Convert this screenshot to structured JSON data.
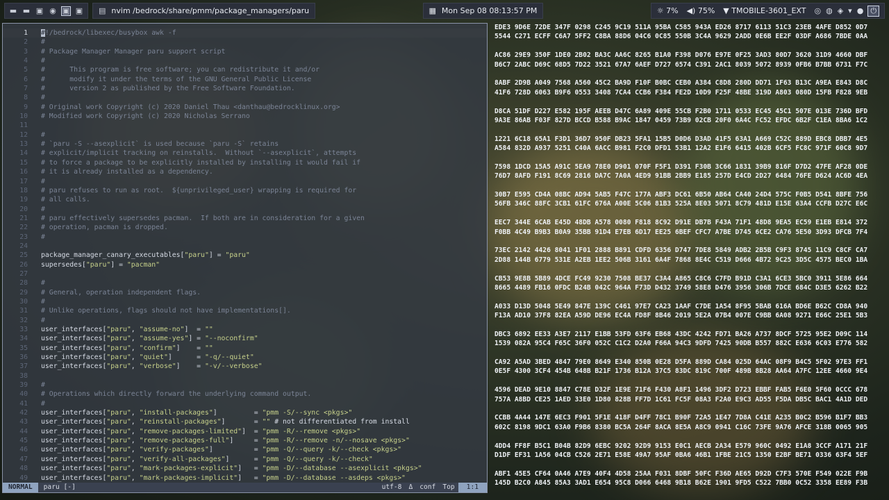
{
  "topbar": {
    "workspaces": [
      {
        "icon": "folder-icon",
        "glyph": "▬",
        "active": false
      },
      {
        "icon": "folder-icon",
        "glyph": "▬",
        "active": false
      },
      {
        "icon": "terminal-icon",
        "glyph": "▣",
        "active": false
      },
      {
        "icon": "browser-icon",
        "glyph": "◉",
        "active": false
      },
      {
        "icon": "terminal-icon",
        "glyph": "▣",
        "active": true
      },
      {
        "icon": "terminal-icon",
        "glyph": "▣",
        "active": false
      }
    ],
    "window_title": "nvim /bedrock/share/pmm/package_managers/paru",
    "clock": "Mon Sep 08  08:13:57 PM",
    "brightness": "7%",
    "volume": "75%",
    "wifi": "TMOBILE-3601_EXT",
    "tray": [
      "discord-icon",
      "steam-icon",
      "network-icon",
      "notification-icon",
      "github-icon",
      "power-icon"
    ]
  },
  "editor": {
    "lines": [
      {
        "n": "1",
        "t": "#!/bedrock/libexec/busybox awk -f",
        "k": "c",
        "cur": true
      },
      {
        "n": "2",
        "t": "#",
        "k": "c"
      },
      {
        "n": "3",
        "t": "# Package Manager Manager paru support script",
        "k": "c"
      },
      {
        "n": "4",
        "t": "#",
        "k": "c"
      },
      {
        "n": "5",
        "t": "#      This program is free software; you can redistribute it and/or",
        "k": "c"
      },
      {
        "n": "6",
        "t": "#      modify it under the terms of the GNU General Public License",
        "k": "c"
      },
      {
        "n": "7",
        "t": "#      version 2 as published by the Free Software Foundation.",
        "k": "c"
      },
      {
        "n": "8",
        "t": "#",
        "k": "c"
      },
      {
        "n": "9",
        "t": "# Original work Copyright (c) 2020 Daniel Thau <danthau@bedrocklinux.org>",
        "k": "c"
      },
      {
        "n": "10",
        "t": "# Modified work Copyright (c) 2020 Nicholas Serrano",
        "k": "c"
      },
      {
        "n": "11",
        "t": "",
        "k": "c"
      },
      {
        "n": "12",
        "t": "#",
        "k": "c"
      },
      {
        "n": "13",
        "t": "# `paru -S --asexplicit` is used because `paru -S` retains",
        "k": "c"
      },
      {
        "n": "14",
        "t": "# explicit/implicit tracking on reinstalls.  Without `--asexplicit`, attempts",
        "k": "c"
      },
      {
        "n": "15",
        "t": "# to force a package to be explicitly installed by installing it would fail if",
        "k": "c"
      },
      {
        "n": "16",
        "t": "# it is already installed as a dependency.",
        "k": "c"
      },
      {
        "n": "17",
        "t": "#",
        "k": "c"
      },
      {
        "n": "18",
        "t": "# paru refuses to run as root.  ${unprivileged_user} wrapping is required for",
        "k": "c"
      },
      {
        "n": "19",
        "t": "# all calls.",
        "k": "c"
      },
      {
        "n": "20",
        "t": "#",
        "k": "c"
      },
      {
        "n": "21",
        "t": "# paru effectively supersedes pacman.  If both are in consideration for a given",
        "k": "c"
      },
      {
        "n": "22",
        "t": "# operation, pacman is dropped.",
        "k": "c"
      },
      {
        "n": "23",
        "t": "#",
        "k": "c"
      },
      {
        "n": "24",
        "t": "",
        "k": "p"
      },
      {
        "n": "25",
        "t": "package_manager_canary_executables[\"paru\"] = \"paru\"",
        "k": "p"
      },
      {
        "n": "26",
        "t": "supersedes[\"paru\"] = \"pacman\"",
        "k": "p"
      },
      {
        "n": "27",
        "t": "",
        "k": "p"
      },
      {
        "n": "28",
        "t": "#",
        "k": "c"
      },
      {
        "n": "29",
        "t": "# General, operation independent flags.",
        "k": "c"
      },
      {
        "n": "30",
        "t": "#",
        "k": "c"
      },
      {
        "n": "31",
        "t": "# Unlike operations, flags should not have implementations[].",
        "k": "c"
      },
      {
        "n": "32",
        "t": "#",
        "k": "c"
      },
      {
        "n": "33",
        "t": "user_interfaces[\"paru\", \"assume-no\"]  = \"\"",
        "k": "p"
      },
      {
        "n": "34",
        "t": "user_interfaces[\"paru\", \"assume-yes\"] = \"--noconfirm\"",
        "k": "p"
      },
      {
        "n": "35",
        "t": "user_interfaces[\"paru\", \"confirm\"]    = \"\"",
        "k": "p"
      },
      {
        "n": "36",
        "t": "user_interfaces[\"paru\", \"quiet\"]      = \"-q/--quiet\"",
        "k": "p"
      },
      {
        "n": "37",
        "t": "user_interfaces[\"paru\", \"verbose\"]    = \"-v/--verbose\"",
        "k": "p"
      },
      {
        "n": "38",
        "t": "",
        "k": "p"
      },
      {
        "n": "39",
        "t": "#",
        "k": "c"
      },
      {
        "n": "40",
        "t": "# Operations which directly forward the underlying command output.",
        "k": "c"
      },
      {
        "n": "41",
        "t": "#",
        "k": "c"
      },
      {
        "n": "42",
        "t": "user_interfaces[\"paru\", \"install-packages\"]         = \"pmm -S/--sync <pkgs>\"",
        "k": "p"
      },
      {
        "n": "43",
        "t": "user_interfaces[\"paru\", \"reinstall-packages\"]       = \"\" # not differentiated from install",
        "k": "p"
      },
      {
        "n": "44",
        "t": "user_interfaces[\"paru\", \"remove-packages-limited\"]  = \"pmm -R/--remove <pkgs>\"",
        "k": "p"
      },
      {
        "n": "45",
        "t": "user_interfaces[\"paru\", \"remove-packages-full\"]     = \"pmm -R/--remove -n/--nosave <pkgs>\"",
        "k": "p"
      },
      {
        "n": "46",
        "t": "user_interfaces[\"paru\", \"verify-packages\"]          = \"pmm -Q/--query -k/--check <pkgs>\"",
        "k": "p"
      },
      {
        "n": "47",
        "t": "user_interfaces[\"paru\", \"verify-all-packages\"]      = \"pmm -Q/--query -k/--check\"",
        "k": "p"
      },
      {
        "n": "48",
        "t": "user_interfaces[\"paru\", \"mark-packages-explicit\"]   = \"pmm -D/--database --asexplicit <pkgs>\"",
        "k": "p"
      },
      {
        "n": "49",
        "t": "user_interfaces[\"paru\", \"mark-packages-implicit\"]   = \"pmm -D/--database --asdeps <pkgs>\"",
        "k": "p"
      }
    ],
    "status": {
      "mode": "NORMAL",
      "file": "paru [-]",
      "encoding": "utf-8",
      "fileformat": "Δ",
      "filetype": "conf",
      "scroll": "Top",
      "position": "1:1"
    }
  },
  "hexpane": {
    "lines": [
      "EDE3 9D6E 72DE 347F 0298 C245 9C19 511A 95BA C585 943A ED26 8717 6113 51C3 23EB 4AFE D852 0D7",
      "5544 C271 ECFF C6A7 5FF2 C8BA 88D6 04C6 0C85 550B 3C4A 9629 2ADD 0E6B EE2F 03DF A686 7BDE 0AA",
      "",
      "AC86 29E9 350F 1DE0 2B02 BA3C AA6C 8265 B1A0 F398 D076 E97E 0F25 3AD3 80D7 3620 31D9 4660 DBF",
      "B6C7 2ABC D69C 68D5 7D22 3521 67A7 6AEF D727 6574 C391 2AC1 8039 5072 8939 0FB6 B7BB 6731 F7C",
      "",
      "8ABF 2D9B A049 7568 A560 45C2 BA9D F10F B0BC CEB0 A384 C8D8 280D DD71 1F63 B13C A9EA E843 D8C",
      "41F6 728D 6063 B9F6 0553 3408 7CA4 CCB6 F384 FE2D 10D9 F25F 48BE 319D A803 080D 15FB F828 9EB",
      "",
      "D8CA 51DF D227 E582 195F AEEB D47C 6A89 409E 55CB F2B0 1711 0533 EC45 45C1 507E 013E 736D BFD",
      "9A3E 86AB F03F 827D BCCD B588 B9AC 1847 0459 73B9 02CB 20F0 6A4C FC52 EFDC 6B2F C1EA 8BA6 1C2",
      "",
      "1221 6C18 65A1 F3D1 36D7 950F DB23 5FA1 15B5 D0D6 D3AD 41F5 63A1 A669 C52C 889D EBC8 DBB7 4E5",
      "A584 832D A937 5251 C40A 6ACC B981 F2C0 DFD1 53B1 12A2 E1F6 6415 402B 6CF5 FC8C 971F 60C8 9D7",
      "",
      "7598 1DCD 15A5 A91C 5EA9 78E0 D901 070F F5F1 D391 F30B 3C66 1831 39B9 816F D7D2 47FE AF28 0DE",
      "76D7 8AFD F191 8C69 2816 DA7C 7A0A 4ED9 91BB 2BB9 E185 257D E4CD 2D27 6484 76FE D624 AC6D 4EA",
      "",
      "30B7 E595 CD4A 08BC AD94 5AB5 F47C 177A ABF3 DC61 6B50 AB64 CA40 24D4 575C F0B5 D541 8BFE 756",
      "56FB 346C 88FC 3CB1 61FC 676A A00E 5C06 81B3 525A 8E03 5071 8C79 481D E15E 63A4 CCFB D27C E6C",
      "",
      "EEC7 344E 6CAB E45D 48DB A578 0080 F818 8C92 D91E DB7B F43A 71F1 48D8 9EA5 EC59 E1EB E814 372",
      "F0BB 4C49 B9B3 B0A9 35BB 91D4 E7EB 6D17 EE25 6BEF CFC7 A7BE D745 6CE2 CA76 5E50 3D93 DFCB 7F4",
      "",
      "73EC 2142 4426 8041 1F01 2888 B891 CDFD 6356 D747 7DE8 5849 ADB2 2B5B C9F3 8745 11C9 C8CF CA7",
      "2D88 144B 6779 531E A2EB 1EE2 506B 3161 6A4F 7868 8E4C C519 D666 4B72 9C25 3D5C 4575 BEC0 1BA",
      "",
      "CB53 9E8B 5B89 4DCE FC49 9230 7508 BE37 C3A4 A865 C8C6 C7FD B91D C3A1 6CE3 5BC0 3911 5E86 664",
      "8665 4489 FB16 0FDC B24B 042C 964A F73D D432 3749 58E8 D476 3956 306B 7DCE 684C D3E5 6262 B22",
      "",
      "A033 D13D 5048 5E49 847E 139C C461 97E7 CA23 1AAF C7DE 1A54 8F95 5BAB 616A BD6E B62C CD8A 940",
      "F13A AD10 37F8 82EA A59D DE96 EC4A FD8F 8B46 2019 5E2A 07B4 007E C9BB 6A08 9271 E66C 25E1 5B3",
      "",
      "DBC3 6892 EE33 A3E7 2117 E1BB 53FD 63F6 EB68 43DC 4242 FD71 BA26 A737 8DCF 5725 95E2 D09C 114",
      "1539 082A 95C4 F65C 36F0 052C C1C2 D2A0 F66A 94C3 9DFD 7425 90DB B557 882C E636 6C03 E776 582",
      "",
      "CA92 A5AD 3BED 4847 79E0 8649 E340 850B 0E28 D5FA 889D CA84 025D 64AC 08F9 B4C5 5F02 97E3 FF1",
      "0E5F 4300 3CF4 454B 648B B21F 1736 B12A 37C5 83DC 819C 700F 489B 8B28 AA64 A7FC 12EE 4660 9E4",
      "",
      "4596 DEAD 9E10 8847 C78E D32F 1E9E 71F6 F430 A8F1 1496 3DF2 D723 EBBF FAB5 F6E0 5F60 0CCC 678",
      "757A A8BD CE25 1AED 33E0 1D80 828B FF7D 1C61 FC5F 08A3 F2A0 E9C3 AD55 F5DA DB5C BAC1 4A1D DED",
      "",
      "CCBB 4A44 147E 6EC3 F901 5F1E 418F D4FF 78C1 B90F 72A5 1E47 7D8A C41E A235 B0C2 B596 B1F7 BB3",
      "602C 8198 9DC1 63A0 F9B6 8380 BC5A 264F 8ACA 8E5A A8C9 0941 C16C 73FE 9A76 AFCE 318B 0065 905",
      "",
      "4DD4 FF8F B5C1 B04B 82D9 6EBC 9202 92D9 9153 E0C1 AECB 2A34 E579 960C 0492 E1A8 3CCF A171 21F",
      "D1DF EF31 1A56 04CB C526 2E71 E58E 49A7 95AF 0BA6 46B1 1FBE 21C5 1350 E2BF BE71 0336 63F4 5EF",
      "",
      "ABF1 45E5 CF64 0A46 A7E9 40F4 4D58 25AA F031 8DBF 50FC F36D AE65 D92D C7F3 570E F549 022E F9B",
      "145D B2C0 A845 85A3 3AD1 E654 95C8 D066 6468 9B18 B62E 1901 9FD5 C522 7BB0 0C52 3358 EE89 F3B"
    ]
  }
}
